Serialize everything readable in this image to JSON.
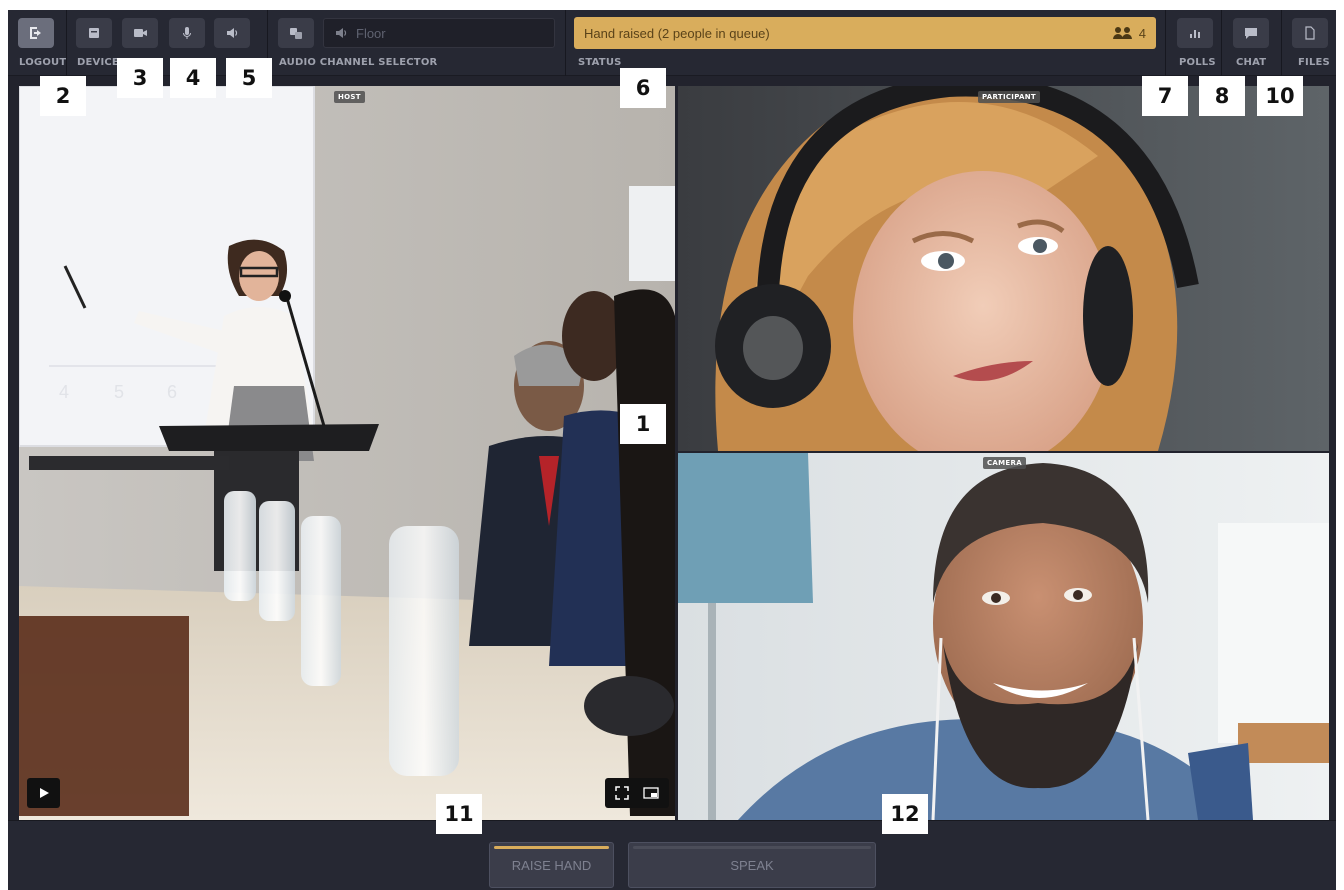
{
  "topbar": {
    "logout_label": "LOGOUT",
    "device_label": "DEVICE S",
    "audio_channel_label": "AUDIO CHANNEL SELECTOR",
    "channel_value": "Floor",
    "status_label": "STATUS",
    "status_text": "Hand raised (2 people in queue)",
    "queue_count": "4",
    "polls_label": "POLLS",
    "chat_label": "CHAT",
    "files_label": "FILES"
  },
  "videos": {
    "host_tag": "HOST",
    "participant_tag": "PARTICIPANT",
    "camera_tag": "CAMERA",
    "slide_numbers": [
      "4",
      "5",
      "6"
    ]
  },
  "bottombar": {
    "raise_hand_label": "RAISE HAND",
    "speak_label": "SPEAK"
  },
  "callouts": [
    "1",
    "2",
    "3",
    "4",
    "5",
    "6",
    "7",
    "8",
    "10",
    "11",
    "12"
  ],
  "colors": {
    "status_bg": "#d9ad5c",
    "raise_hand_accent": "#d9ad5c",
    "bar_bg": "#262833"
  }
}
